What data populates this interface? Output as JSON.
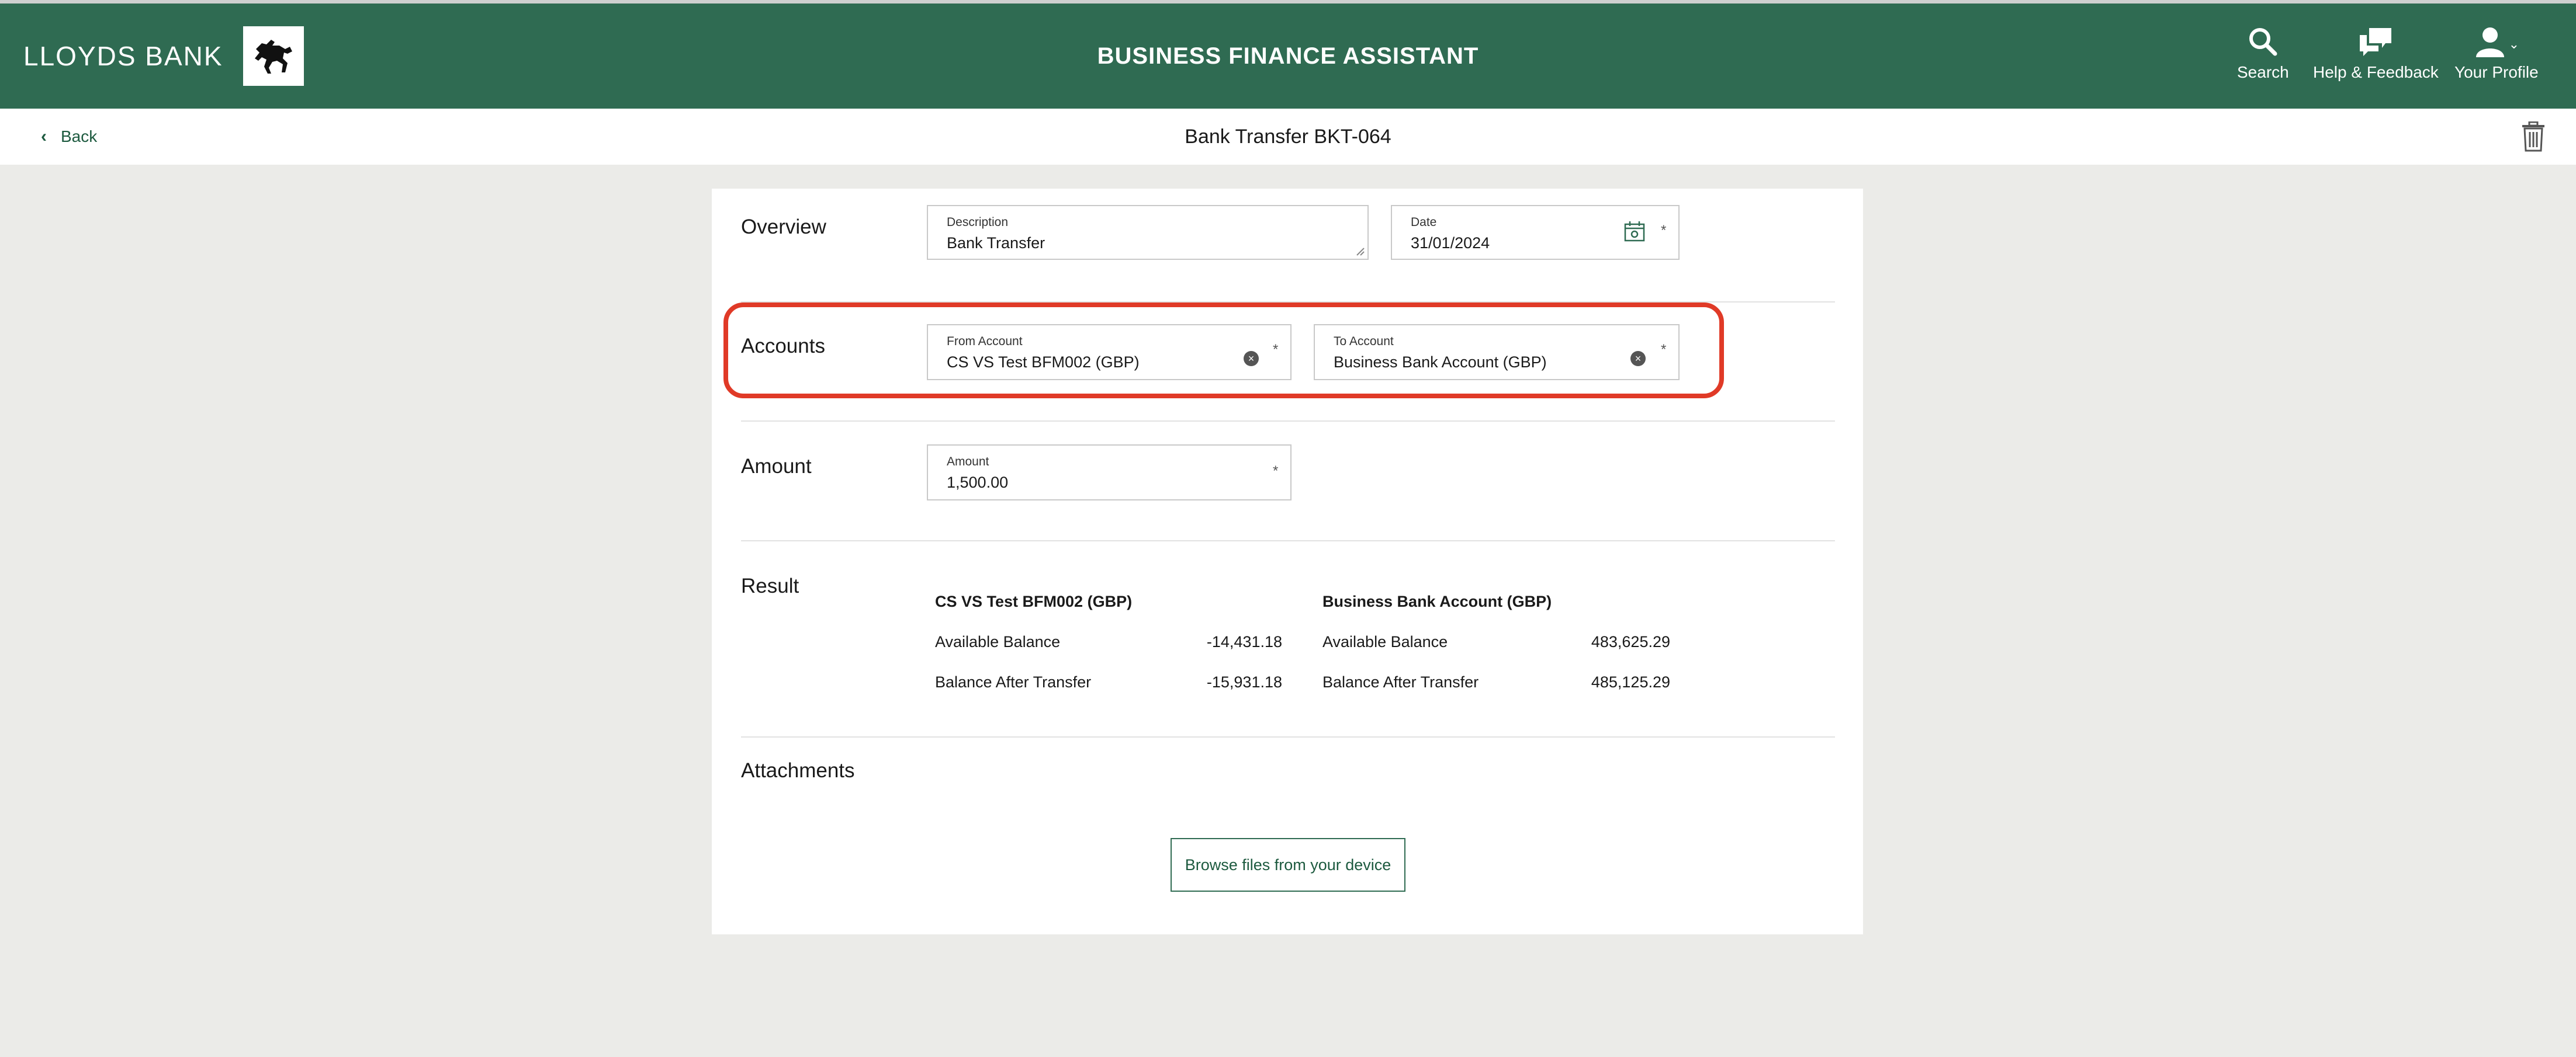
{
  "brand": {
    "name": "LLOYDS BANK"
  },
  "header": {
    "title": "BUSINESS FINANCE ASSISTANT",
    "search_label": "Search",
    "help_label": "Help & Feedback",
    "profile_label": "Your Profile"
  },
  "subheader": {
    "back_label": "Back",
    "title": "Bank Transfer BKT-064"
  },
  "overview": {
    "label": "Overview",
    "description_label": "Description",
    "description_value": "Bank Transfer",
    "date_label": "Date",
    "date_value": "31/01/2024",
    "required_mark": "*"
  },
  "accounts": {
    "label": "Accounts",
    "from_label": "From Account",
    "from_value": "CS VS Test BFM002 (GBP)",
    "to_label": "To Account",
    "to_value": "Business Bank Account (GBP)",
    "required_mark": "*"
  },
  "amount": {
    "label": "Amount",
    "field_label": "Amount",
    "value": "1,500.00",
    "required_mark": "*"
  },
  "result": {
    "label": "Result",
    "from": {
      "account": "CS VS Test BFM002 (GBP)",
      "available_label": "Available Balance",
      "available_value": "-14,431.18",
      "after_label": "Balance After Transfer",
      "after_value": "-15,931.18"
    },
    "to": {
      "account": "Business Bank Account (GBP)",
      "available_label": "Available Balance",
      "available_value": "483,625.29",
      "after_label": "Balance After Transfer",
      "after_value": "485,125.29"
    }
  },
  "attachments": {
    "label": "Attachments",
    "browse_label": "Browse files from your device"
  },
  "colors": {
    "brand_green": "#2f6b52",
    "highlight_red": "#e03a27",
    "background": "#ebebe8"
  },
  "icons": [
    "horse-logo-icon",
    "search-icon",
    "chat-bubbles-icon",
    "user-icon",
    "chevron-down-icon",
    "chevron-left-icon",
    "trash-icon",
    "calendar-icon",
    "clear-icon"
  ]
}
